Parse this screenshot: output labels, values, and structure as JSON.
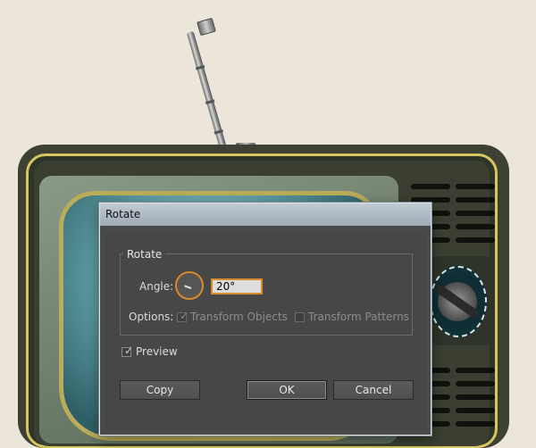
{
  "dialog": {
    "title": "Rotate",
    "group_label": "Rotate",
    "angle_label": "Angle:",
    "angle_value": "20°",
    "options_label": "Options:",
    "transform_objects": {
      "label": "Transform Objects",
      "checked": true,
      "disabled": true
    },
    "transform_patterns": {
      "label": "Transform Patterns",
      "checked": false,
      "disabled": true
    },
    "preview": {
      "label": "Preview",
      "checked": true
    },
    "buttons": {
      "copy": "Copy",
      "ok": "OK",
      "cancel": "Cancel"
    },
    "check_glyph": "✓"
  },
  "colors": {
    "dialog_bg": "#4a4a4a",
    "focus_accent": "#d98a2b",
    "tv_body": "#3c4133",
    "tv_trim": "#d8c760",
    "screen": "#5b9aa1",
    "page_bg": "#ebe5da"
  },
  "icons": {
    "angle_dial": "angle-dial-icon",
    "checkmark": "checkmark-icon"
  }
}
